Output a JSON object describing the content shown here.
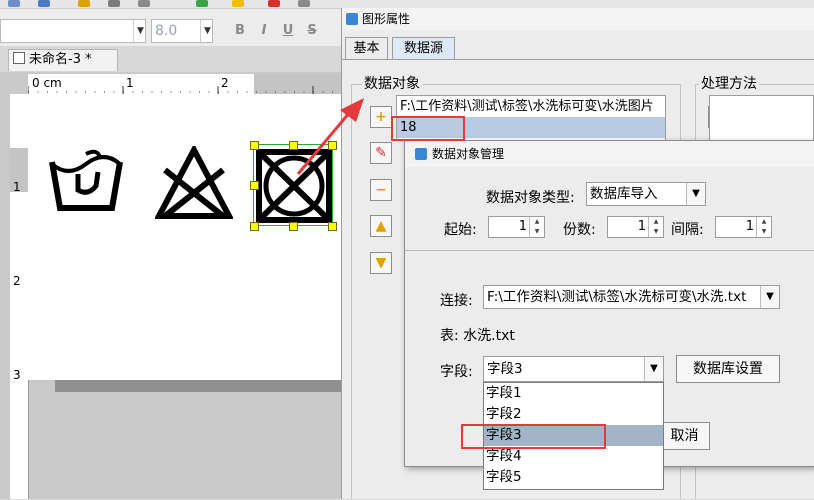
{
  "toolbar": {
    "font_size": "8.0",
    "bold_label": "B",
    "italic_label": "I",
    "underline_label": "U",
    "strike_label": "S"
  },
  "document": {
    "tab_title": "未命名-3 *"
  },
  "ruler": {
    "h_labels": [
      "0 cm",
      "1",
      "2"
    ],
    "v_labels": [
      "1",
      "2",
      "3"
    ]
  },
  "property_window": {
    "title": "图形属性",
    "tabs": [
      "基本",
      "数据源"
    ],
    "data_object_label": "数据对象",
    "processing_label": "处理方法",
    "data_objects": [
      "F:\\工作资料\\测试\\标签\\水洗标可变\\水洗图片",
      "18"
    ]
  },
  "dialog": {
    "title": "数据对象管理",
    "type_label": "数据对象类型:",
    "type_value": "数据库导入",
    "start_label": "起始:",
    "start_value": "1",
    "copies_label": "份数:",
    "copies_value": "1",
    "interval_label": "间隔:",
    "interval_value": "1",
    "connection_label": "连接:",
    "connection_value": "F:\\工作资料\\测试\\标签\\水洗标可变\\水洗.txt",
    "table_label": "表: 水洗.txt",
    "field_label": "字段:",
    "field_value": "字段3",
    "db_settings_button": "数据库设置",
    "cancel_button": "取消",
    "field_options": [
      "字段1",
      "字段2",
      "字段3",
      "字段4",
      "字段5"
    ]
  },
  "colors": {
    "annotation_red": "#e5393b",
    "selection_yellow": "#ffff00",
    "list_highlight": "#a4b4c8"
  }
}
